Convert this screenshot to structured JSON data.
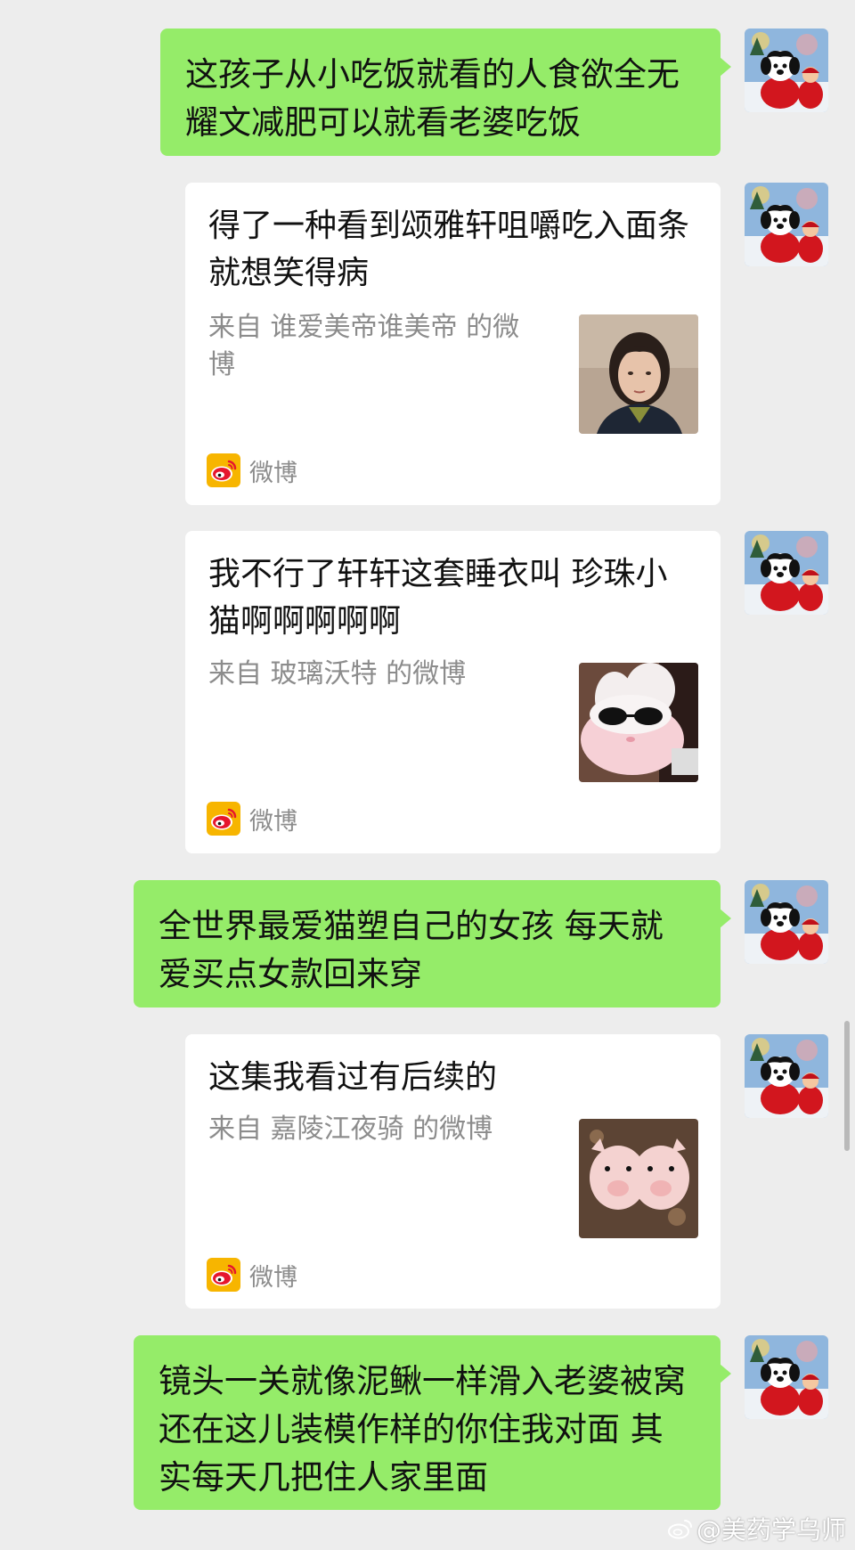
{
  "messages": [
    {
      "type": "text",
      "text": "这孩子从小吃饭就看的人食欲全无 耀文减肥可以就看老婆吃饭"
    },
    {
      "type": "card",
      "title": "得了一种看到颂雅轩咀嚼吃入面条就想笑得病",
      "source": "来自 谁爱美帝谁美帝 的微博",
      "app": "微博",
      "thumb": "woman-portrait"
    },
    {
      "type": "card",
      "title": "我不行了轩轩这套睡衣叫 珍珠小猫啊啊啊啊啊",
      "source": "来自 玻璃沃特 的微博",
      "app": "微博",
      "thumb": "pink-sunglasses-plush"
    },
    {
      "type": "text",
      "text": "全世界最爱猫塑自己的女孩 每天就爱买点女款回来穿"
    },
    {
      "type": "card",
      "title": "这集我看过有后续的",
      "source": "来自 嘉陵江夜骑 的微博",
      "app": "微博",
      "thumb": "pig-plush-pair"
    },
    {
      "type": "text",
      "text": "镜头一关就像泥鳅一样滑入老婆被窝 还在这儿装模作样的你住我对面 其实每天几把住人家里面"
    }
  ],
  "avatar": "dog-plush-red-outfit",
  "watermark": "@美药学乌师",
  "colors": {
    "background": "#ededed",
    "bubble_green": "#95ec69",
    "card_white": "#ffffff",
    "weibo_red": "#e6162d",
    "weibo_yellow": "#f7b500"
  }
}
